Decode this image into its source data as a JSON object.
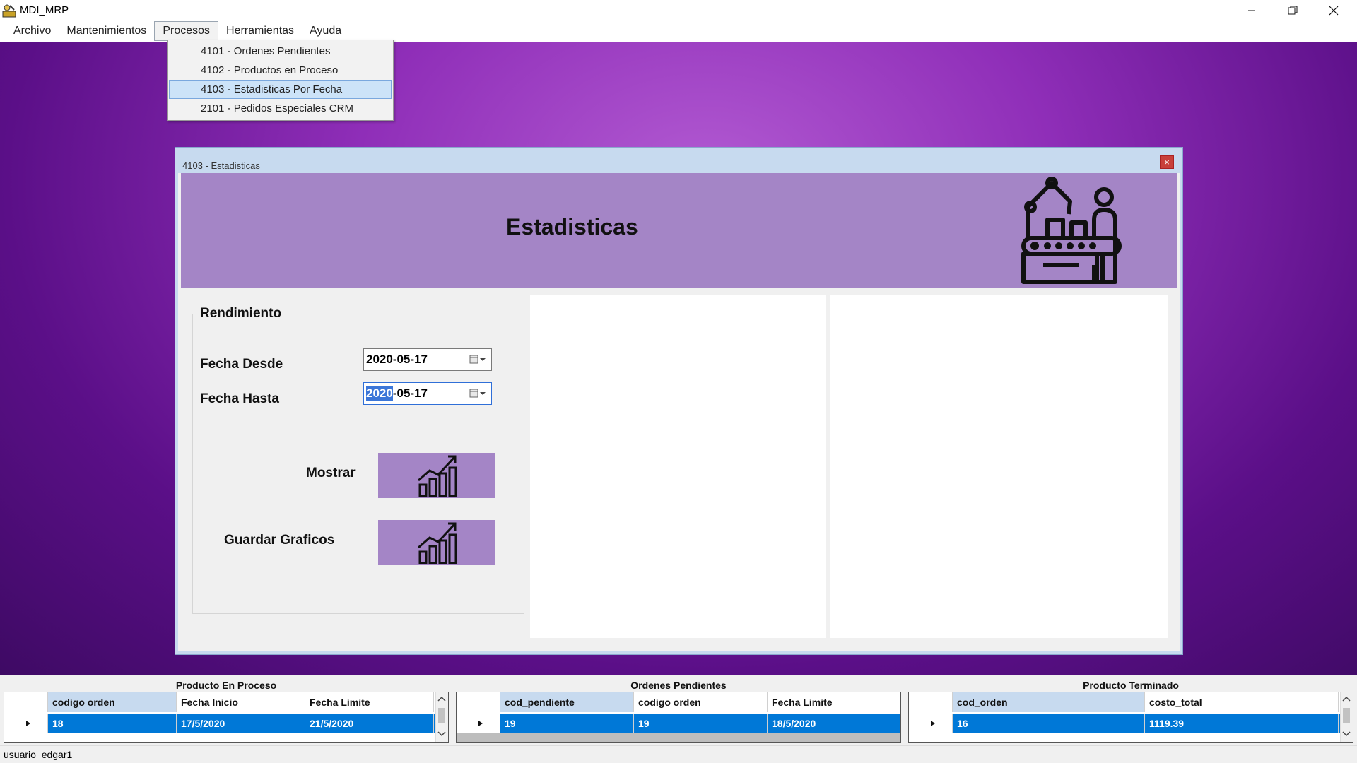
{
  "window": {
    "title": "MDI_MRP"
  },
  "menu": {
    "items": [
      {
        "label": "Archivo"
      },
      {
        "label": "Mantenimientos"
      },
      {
        "label": "Procesos"
      },
      {
        "label": "Herramientas"
      },
      {
        "label": "Ayuda"
      }
    ],
    "dropdown": [
      {
        "label": "4101 - Ordenes Pendientes"
      },
      {
        "label": "4102 - Productos en Proceso"
      },
      {
        "label": "4103 - Estadisticas Por Fecha"
      },
      {
        "label": "2101 - Pedidos Especiales CRM"
      }
    ]
  },
  "child": {
    "title": "4103 - Estadisticas",
    "close": "×",
    "banner_title": "Estadisticas",
    "group_title": "Rendimiento",
    "fecha_desde_label": "Fecha Desde",
    "fecha_desde_value": "2020-05-17",
    "fecha_hasta_label": "Fecha Hasta",
    "fecha_hasta_selected": "2020",
    "fecha_hasta_rest": "-05-17",
    "mostrar_label": "Mostrar",
    "guardar_label": "Guardar Graficos"
  },
  "grids": {
    "proceso": {
      "caption": "Producto En Proceso",
      "headers": [
        "codigo orden",
        "Fecha Inicio",
        "Fecha Limite"
      ],
      "row": [
        "18",
        "17/5/2020",
        "21/5/2020"
      ]
    },
    "pendientes": {
      "caption": "Ordenes Pendientes",
      "headers": [
        "cod_pendiente",
        "codigo orden",
        "Fecha Limite"
      ],
      "row": [
        "19",
        "19",
        "18/5/2020"
      ]
    },
    "terminado": {
      "caption": "Producto Terminado",
      "headers": [
        "cod_orden",
        "costo_total"
      ],
      "row": [
        "16",
        "1119.39"
      ]
    }
  },
  "status": {
    "text": "usuario  edgar1"
  },
  "colors": {
    "banner": "#a485c6",
    "selection": "#0078d7",
    "menu_highlight": "#cce3f8"
  }
}
